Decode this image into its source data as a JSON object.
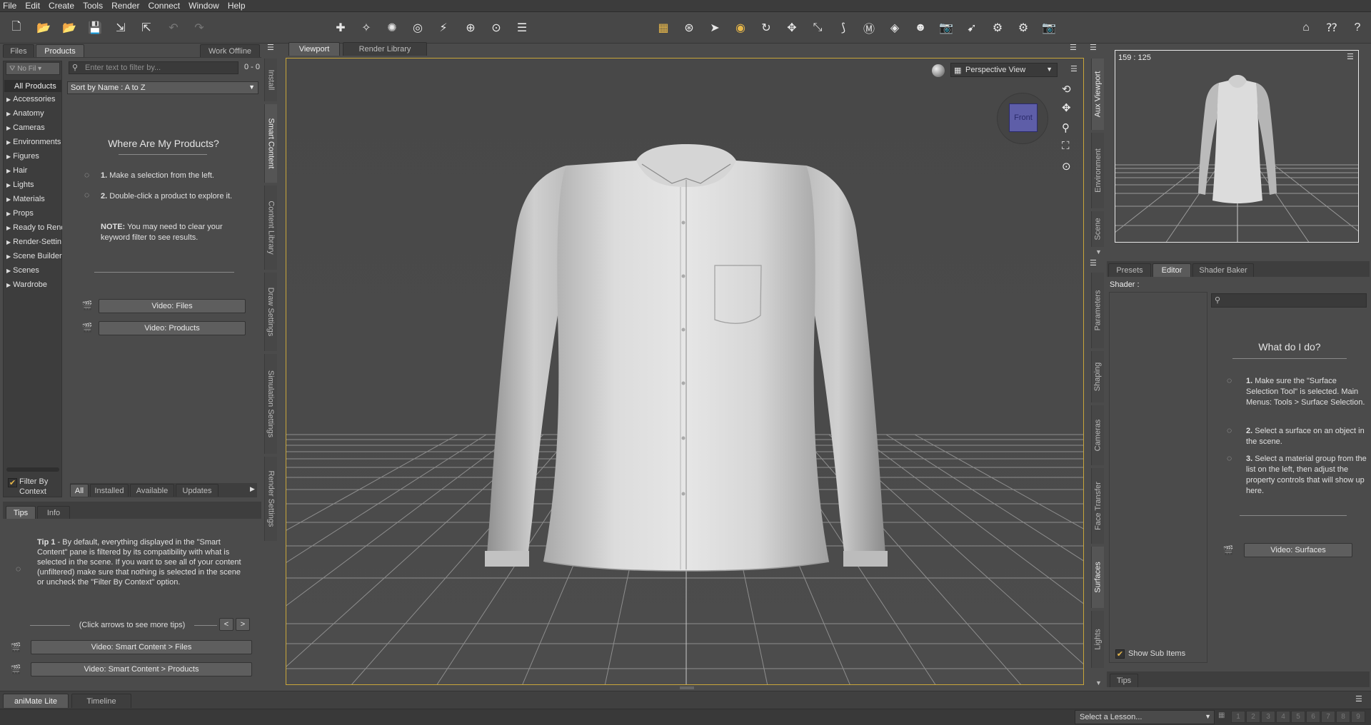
{
  "menu": [
    "File",
    "Edit",
    "Create",
    "Tools",
    "Render",
    "Connect",
    "Window",
    "Help"
  ],
  "left_panel": {
    "tabs": [
      "Files",
      "Products"
    ],
    "work_offline": "Work Offline",
    "filter_dropdown": "No Fil",
    "all_products": "All Products",
    "categories": [
      "Accessories",
      "Anatomy",
      "Cameras",
      "Environments",
      "Figures",
      "Hair",
      "Lights",
      "Materials",
      "Props",
      "Ready to Rend",
      "Render-Settin",
      "Scene Builder",
      "Scenes",
      "Wardrobe"
    ],
    "search_placeholder": "Enter text to filter by...",
    "result_count": "0 - 0",
    "sort_label": "Sort by Name : A to Z",
    "where_title": "Where Are My Products?",
    "step1_num": "1.",
    "step1": "Make a selection from the left.",
    "step2_num": "2.",
    "step2": "Double-click a product to explore it.",
    "note_label": "NOTE:",
    "note": "You may need to clear your keyword filter to see results.",
    "video_files": "Video: Files",
    "video_products": "Video: Products",
    "filter_by_context": "Filter By Context",
    "bottom_tabs": [
      "All",
      "Installed",
      "Available",
      "Updates"
    ],
    "vtabs": [
      "Install",
      "Smart Content",
      "Content Library",
      "Draw Settings",
      "Simulation Settings",
      "Render Settings"
    ]
  },
  "tips_panel": {
    "tabs": [
      "Tips",
      "Info"
    ],
    "tip_label": "Tip 1",
    "tip_text": "- By default, everything displayed in the \"Smart Content\" pane is filtered by its compatibility with what is selected in the scene. If you want to see all of your content (unfiltered) make sure that nothing is selected in the scene or uncheck the \"Filter By Context\" option.",
    "click_arrows": "(Click arrows to see more tips)",
    "prev": "<",
    "next": ">",
    "video_sc_files": "Video: Smart Content > Files",
    "video_sc_products": "Video: Smart Content > Products"
  },
  "viewport": {
    "tabs": [
      "Viewport",
      "Render Library"
    ],
    "view_select": "Perspective View",
    "cube_label": "Front"
  },
  "aux": {
    "dims": "159 : 125",
    "vtabs": [
      "Aux Viewport",
      "Environment",
      "Scene"
    ]
  },
  "surfaces": {
    "tabs": [
      "Presets",
      "Editor",
      "Shader Baker"
    ],
    "shader_label": "Shader :",
    "what_title": "What do I do?",
    "s1_num": "1.",
    "s1": "Make sure the \"Surface Selection Tool\" is selected. Main Menus: Tools > Surface Selection.",
    "s2_num": "2.",
    "s2": "Select a surface on an object in the scene.",
    "s3_num": "3.",
    "s3": "Select a material group from the list on the left, then adjust the property controls that will show up here.",
    "video_surfaces": "Video: Surfaces",
    "show_sub_items": "Show Sub Items",
    "tips_tab": "Tips",
    "vtabs": [
      "Parameters",
      "Shaping",
      "Cameras",
      "Face Transfer",
      "Surfaces",
      "Lights"
    ]
  },
  "bottom": {
    "tabs": [
      "aniMate Lite",
      "Timeline"
    ],
    "lesson_select": "Select a Lesson...",
    "lesson_steps": [
      "1",
      "2",
      "3",
      "4",
      "5",
      "6",
      "7",
      "8",
      "9"
    ]
  }
}
